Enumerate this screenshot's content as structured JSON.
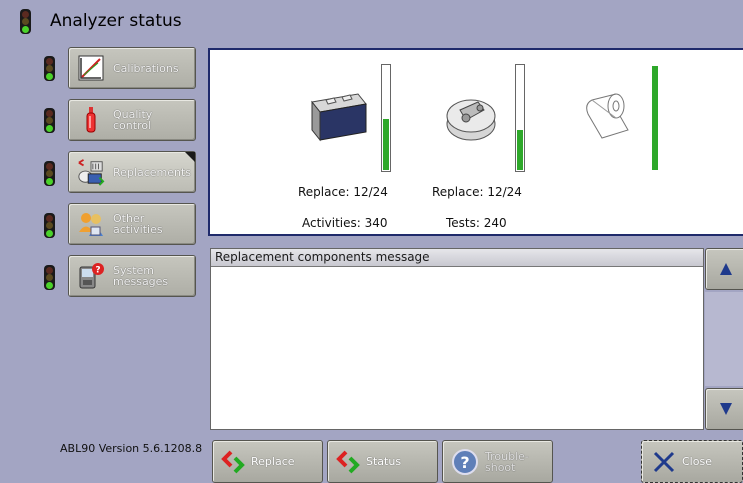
{
  "title": "Analyzer status",
  "nav": [
    {
      "label": "Calibrations",
      "icon": "calibration-chart-icon"
    },
    {
      "label": "Quality\ncontrol",
      "icon": "ampoule-icon"
    },
    {
      "label": "Replacements",
      "icon": "replacement-parts-icon",
      "active": true
    },
    {
      "label": "Other\nactivities",
      "icon": "people-icon"
    },
    {
      "label": "System\nmessages",
      "icon": "device-alert-icon"
    }
  ],
  "version": "ABL90 Version 5.6.1208.8",
  "components": [
    {
      "name": "sensor-cassette",
      "icon": "cassette-icon",
      "level": 0.5,
      "line1": "Replace: 12/24",
      "line2": "Activities: 340"
    },
    {
      "name": "solution-pack",
      "icon": "solution-pack-icon",
      "level": 0.4,
      "line1": "Replace: 12/24",
      "line2": "Tests: 240"
    },
    {
      "name": "paper-roll",
      "icon": "paper-roll-icon",
      "level": 1.0,
      "line1": "",
      "line2": ""
    }
  ],
  "message_header": "Replacement components message",
  "buttons": {
    "replace": "Replace",
    "status": "Status",
    "troubleshoot": "Trouble-\nshoot",
    "close": "Close"
  },
  "colors": {
    "accent": "#1f2a6b",
    "level": "#2ea82a",
    "background": "#a3a5c3"
  }
}
